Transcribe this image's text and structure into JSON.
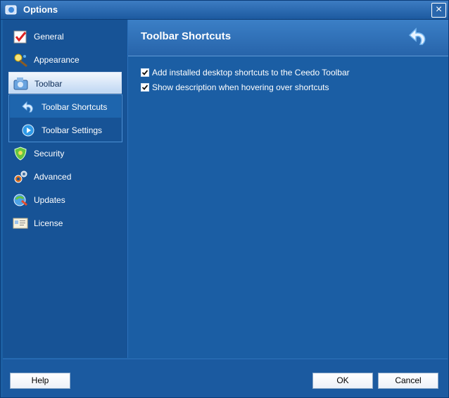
{
  "window": {
    "title": "Options"
  },
  "sidebar": {
    "items": [
      {
        "label": "General",
        "icon": "general-icon"
      },
      {
        "label": "Appearance",
        "icon": "appearance-icon"
      },
      {
        "label": "Toolbar",
        "icon": "toolbar-icon",
        "selected": true
      },
      {
        "label": "Security",
        "icon": "security-icon"
      },
      {
        "label": "Advanced",
        "icon": "advanced-icon"
      },
      {
        "label": "Updates",
        "icon": "updates-icon"
      },
      {
        "label": "License",
        "icon": "license-icon"
      }
    ],
    "subitems": [
      {
        "label": "Toolbar Shortcuts",
        "icon": "back-arrow-icon",
        "active": true
      },
      {
        "label": "Toolbar Settings",
        "icon": "play-icon"
      }
    ]
  },
  "content": {
    "title": "Toolbar Shortcuts",
    "options": [
      {
        "label": "Add installed desktop shortcuts to the Ceedo Toolbar",
        "checked": true
      },
      {
        "label": "Show description when hovering over shortcuts",
        "checked": true
      }
    ]
  },
  "footer": {
    "help": "Help",
    "ok": "OK",
    "cancel": "Cancel"
  }
}
